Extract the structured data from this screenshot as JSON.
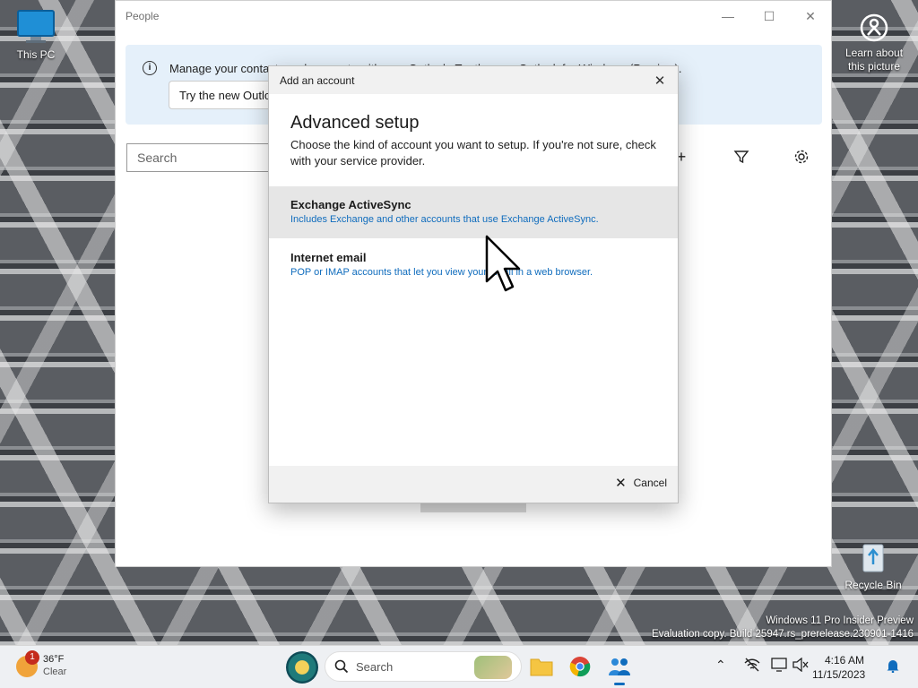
{
  "desktop": {
    "this_pc": "This PC",
    "learn_about": "Learn about this picture",
    "recycle_bin": "Recycle Bin",
    "watermark_line1": "Windows 11 Pro Insider Preview",
    "watermark_line2": "Evaluation copy. Build 25947.rs_prerelease.230901-1416"
  },
  "window": {
    "title": "People",
    "banner_message": "Manage your contacts and accounts with new Outlook. Try the new Outlook for Windows (Preview).",
    "banner_button": "Try the new Outlook",
    "search_placeholder": "Search"
  },
  "dialog": {
    "title": "Add an account",
    "heading": "Advanced setup",
    "description": "Choose the kind of account you want to setup. If you're not sure, check with your service provider.",
    "options": [
      {
        "title": "Exchange ActiveSync",
        "subtitle": "Includes Exchange and other accounts that use Exchange ActiveSync."
      },
      {
        "title": "Internet email",
        "subtitle": "POP or IMAP accounts that let you view your email in a web browser."
      }
    ],
    "cancel": "Cancel"
  },
  "taskbar": {
    "weather_temp": "36°F",
    "weather_condition": "Clear",
    "weather_badge": "1",
    "search": "Search",
    "time": "4:16 AM",
    "date": "11/15/2023"
  },
  "colors": {
    "accent": "#0f6cbd",
    "banner_bg": "#e5f0fa",
    "highlight_row": "#e6e6e6"
  }
}
